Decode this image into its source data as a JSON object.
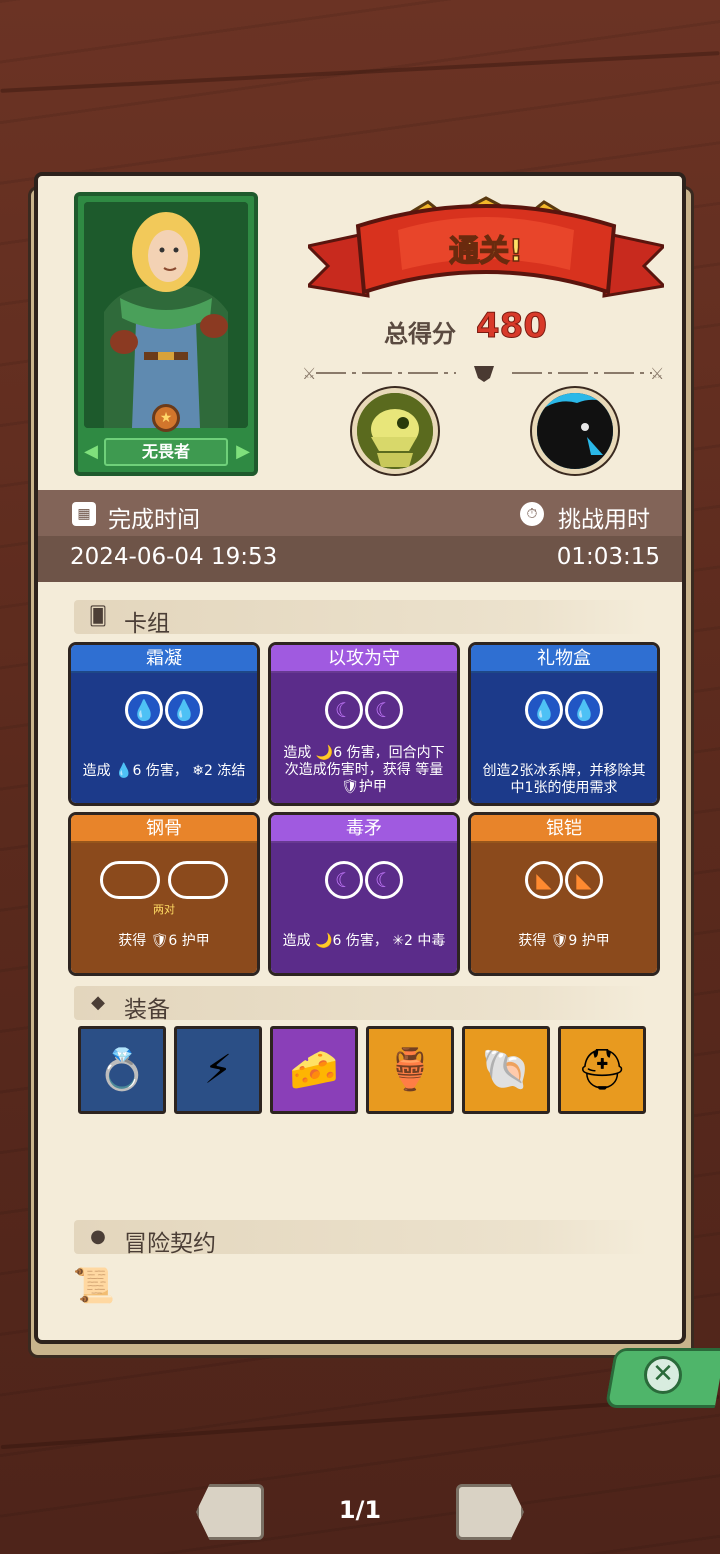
{
  "result": {
    "banner_text": "通关!",
    "score_label": "总得分",
    "score_value": "480"
  },
  "hero": {
    "name": "无畏者"
  },
  "time": {
    "completion_label": "完成时间",
    "completion_value": "2024-06-04 19:53",
    "challenge_label": "挑战用时",
    "challenge_value": "01:03:15"
  },
  "sections": {
    "deck": "卡组",
    "equipment": "装备",
    "contract": "冒险契约"
  },
  "cards": [
    {
      "title": "霜凝",
      "color": "blue",
      "gem": "water",
      "desc": "造成 💧6 伤害， ❄2 冻结",
      "sub": ""
    },
    {
      "title": "以攻为守",
      "color": "purple",
      "gem": "moon",
      "desc": "造成 🌙6 伤害，回合内下次造成伤害时，获得 等量 🛡护甲",
      "sub": ""
    },
    {
      "title": "礼物盒",
      "color": "blue",
      "gem": "water",
      "desc": "创造2张冰系牌，并移除其中1张的使用需求",
      "sub": ""
    },
    {
      "title": "钢骨",
      "color": "orange",
      "gem": "empty-pair",
      "desc": "获得 🛡6 护甲",
      "sub": "两对"
    },
    {
      "title": "毒矛",
      "color": "purple",
      "gem": "moon",
      "desc": "造成 🌙6 伤害， ✳2 中毒",
      "sub": ""
    },
    {
      "title": "银铠",
      "color": "orange",
      "gem": "rock",
      "desc": "获得 🛡9 护甲",
      "sub": ""
    }
  ],
  "equipment": [
    {
      "name": "ring-icon",
      "bg": "#2b4f86",
      "glyph": "💍"
    },
    {
      "name": "lightning-orb-icon",
      "bg": "#2b4f86",
      "glyph": "⚡"
    },
    {
      "name": "cheese-icon",
      "bg": "#8a3fb8",
      "glyph": "🧀"
    },
    {
      "name": "vase-icon",
      "bg": "#e89a1f",
      "glyph": "🏺"
    },
    {
      "name": "shell-icon",
      "bg": "#e89a1f",
      "glyph": "🐚"
    },
    {
      "name": "helmet-icon",
      "bg": "#e89a1f",
      "glyph": "⛑"
    }
  ],
  "pager": {
    "text": "1/1"
  },
  "colors": {
    "panel": "#f4ecd9",
    "accent_red": "#d83a2a",
    "band": "#6e5448"
  }
}
